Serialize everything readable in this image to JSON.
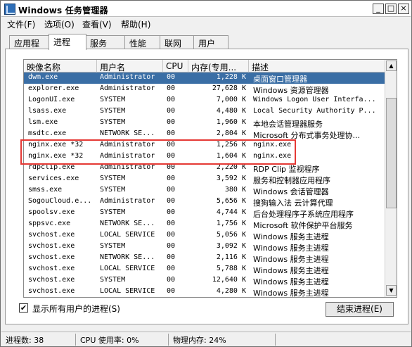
{
  "window": {
    "title": "Windows 任务管理器",
    "buttons": {
      "minimize": "_",
      "maximize": "□",
      "close": "×"
    }
  },
  "menu": [
    "文件(F)",
    "选项(O)",
    "查看(V)",
    "帮助(H)"
  ],
  "tabs": [
    "应用程序",
    "进程",
    "服务",
    "性能",
    "联网",
    "用户"
  ],
  "columns": [
    "映像名称",
    "用户名",
    "CPU",
    "内存(专用...",
    "描述"
  ],
  "rows": [
    {
      "name": "dwm.exe",
      "user": "Administrator",
      "cpu": "00",
      "mem": "1,228 K",
      "desc": "桌面窗口管理器",
      "selected": true
    },
    {
      "name": "explorer.exe",
      "user": "Administrator",
      "cpu": "00",
      "mem": "27,628 K",
      "desc": "Windows 资源管理器"
    },
    {
      "name": "LogonUI.exe",
      "user": "SYSTEM",
      "cpu": "00",
      "mem": "7,000 K",
      "desc": "Windows Logon User Interfa..."
    },
    {
      "name": "lsass.exe",
      "user": "SYSTEM",
      "cpu": "00",
      "mem": "4,480 K",
      "desc": "Local Security Authority P..."
    },
    {
      "name": "lsm.exe",
      "user": "SYSTEM",
      "cpu": "00",
      "mem": "1,960 K",
      "desc": "本地会话管理器服务"
    },
    {
      "name": "msdtc.exe",
      "user": "NETWORK SE...",
      "cpu": "00",
      "mem": "2,804 K",
      "desc": "Microsoft 分布式事务处理协..."
    },
    {
      "name": "nginx.exe *32",
      "user": "Administrator",
      "cpu": "00",
      "mem": "1,256 K",
      "desc": "nginx.exe"
    },
    {
      "name": "nginx.exe *32",
      "user": "Administrator",
      "cpu": "00",
      "mem": "1,604 K",
      "desc": "nginx.exe"
    },
    {
      "name": "rdpclip.exe",
      "user": "Administrator",
      "cpu": "00",
      "mem": "2,220 K",
      "desc": "RDP Clip 监视程序"
    },
    {
      "name": "services.exe",
      "user": "SYSTEM",
      "cpu": "00",
      "mem": "3,592 K",
      "desc": "服务和控制器应用程序"
    },
    {
      "name": "smss.exe",
      "user": "SYSTEM",
      "cpu": "00",
      "mem": "380 K",
      "desc": "Windows 会话管理器"
    },
    {
      "name": "SogouCloud.e...",
      "user": "Administrator",
      "cpu": "00",
      "mem": "5,656 K",
      "desc": "搜狗输入法 云计算代理"
    },
    {
      "name": "spoolsv.exe",
      "user": "SYSTEM",
      "cpu": "00",
      "mem": "4,744 K",
      "desc": "后台处理程序子系统应用程序"
    },
    {
      "name": "sppsvc.exe",
      "user": "NETWORK SE...",
      "cpu": "00",
      "mem": "1,756 K",
      "desc": "Microsoft 软件保护平台服务"
    },
    {
      "name": "svchost.exe",
      "user": "LOCAL SERVICE",
      "cpu": "00",
      "mem": "5,056 K",
      "desc": "Windows 服务主进程"
    },
    {
      "name": "svchost.exe",
      "user": "SYSTEM",
      "cpu": "00",
      "mem": "3,092 K",
      "desc": "Windows 服务主进程"
    },
    {
      "name": "svchost.exe",
      "user": "NETWORK SE...",
      "cpu": "00",
      "mem": "2,116 K",
      "desc": "Windows 服务主进程"
    },
    {
      "name": "svchost.exe",
      "user": "LOCAL SERVICE",
      "cpu": "00",
      "mem": "5,788 K",
      "desc": "Windows 服务主进程"
    },
    {
      "name": "svchost.exe",
      "user": "SYSTEM",
      "cpu": "00",
      "mem": "12,640 K",
      "desc": "Windows 服务主进程"
    },
    {
      "name": "svchost.exe",
      "user": "LOCAL SERVICE",
      "cpu": "00",
      "mem": "4,280 K",
      "desc": "Windows 服务主进程"
    }
  ],
  "show_all_users": {
    "label": "显示所有用户的进程(S)",
    "checked": "✔"
  },
  "end_process_label": "结束进程(E)",
  "status": {
    "processes": "进程数: 38",
    "cpu": "CPU 使用率: 0%",
    "memory": "物理内存: 24%"
  },
  "colors": {
    "selection": "#3a6ea5",
    "highlight_box": "#e53935"
  }
}
